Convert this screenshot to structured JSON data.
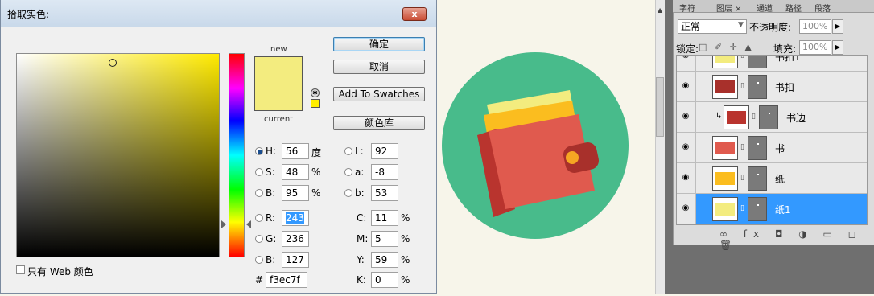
{
  "picker": {
    "title": "拾取实色:",
    "close_label": "x",
    "new_label": "new",
    "current_label": "current",
    "new_color": "#f3ec7f",
    "current_color": "#f3ec7f",
    "buttons": {
      "ok": "确定",
      "cancel": "取消",
      "add_swatches": "Add To Swatches",
      "library": "颜色库"
    },
    "hsb": {
      "h": {
        "label": "H:",
        "value": "56",
        "unit": "度"
      },
      "s": {
        "label": "S:",
        "value": "48",
        "unit": "%"
      },
      "b": {
        "label": "B:",
        "value": "95",
        "unit": "%"
      }
    },
    "rgb": {
      "r": {
        "label": "R:",
        "value": "243"
      },
      "g": {
        "label": "G:",
        "value": "236"
      },
      "b": {
        "label": "B:",
        "value": "127"
      }
    },
    "lab": {
      "l": {
        "label": "L:",
        "value": "92"
      },
      "a": {
        "label": "a:",
        "value": "-8"
      },
      "b": {
        "label": "b:",
        "value": "53"
      }
    },
    "cmyk": {
      "c": {
        "label": "C:",
        "value": "11",
        "unit": "%"
      },
      "m": {
        "label": "M:",
        "value": "5",
        "unit": "%"
      },
      "y": {
        "label": "Y:",
        "value": "59",
        "unit": "%"
      },
      "k": {
        "label": "K:",
        "value": "0",
        "unit": "%"
      }
    },
    "hex": {
      "label": "#",
      "value": "f3ec7f"
    },
    "web_only_label": "只有 Web 颜色"
  },
  "layers": {
    "tabs": [
      "字符",
      "图层 ×",
      "通道",
      "路径",
      "段落"
    ],
    "blend_mode": "正常",
    "opacity_label": "不透明度:",
    "opacity_value": "100%",
    "lock_label": "锁定:",
    "lock_icons": "□ ✐ ✛ ▲",
    "fill_label": "填充:",
    "fill_value": "100%",
    "items": [
      {
        "name": "书扣1",
        "color": "#f3ec7f"
      },
      {
        "name": "书扣",
        "color": "#a8302b"
      },
      {
        "name": "书边",
        "color": "#b9342e"
      },
      {
        "name": "书",
        "color": "#e05a4e"
      },
      {
        "name": "纸",
        "color": "#fbbd1f"
      },
      {
        "name": "纸1",
        "color": "#f3ec7f"
      }
    ],
    "footer_icons": "∞ fx ◘ ◑ ▭ ◻ 🗑"
  },
  "canvas": {
    "circle_color": "#48bb8b",
    "wallet_color": "#e05a4e",
    "wallet_side_color": "#b9342e",
    "paper_color": "#fbbd1f",
    "paper2_color": "#f3ec7f",
    "clasp_color": "#a8302b",
    "button_color": "#f6a623"
  }
}
